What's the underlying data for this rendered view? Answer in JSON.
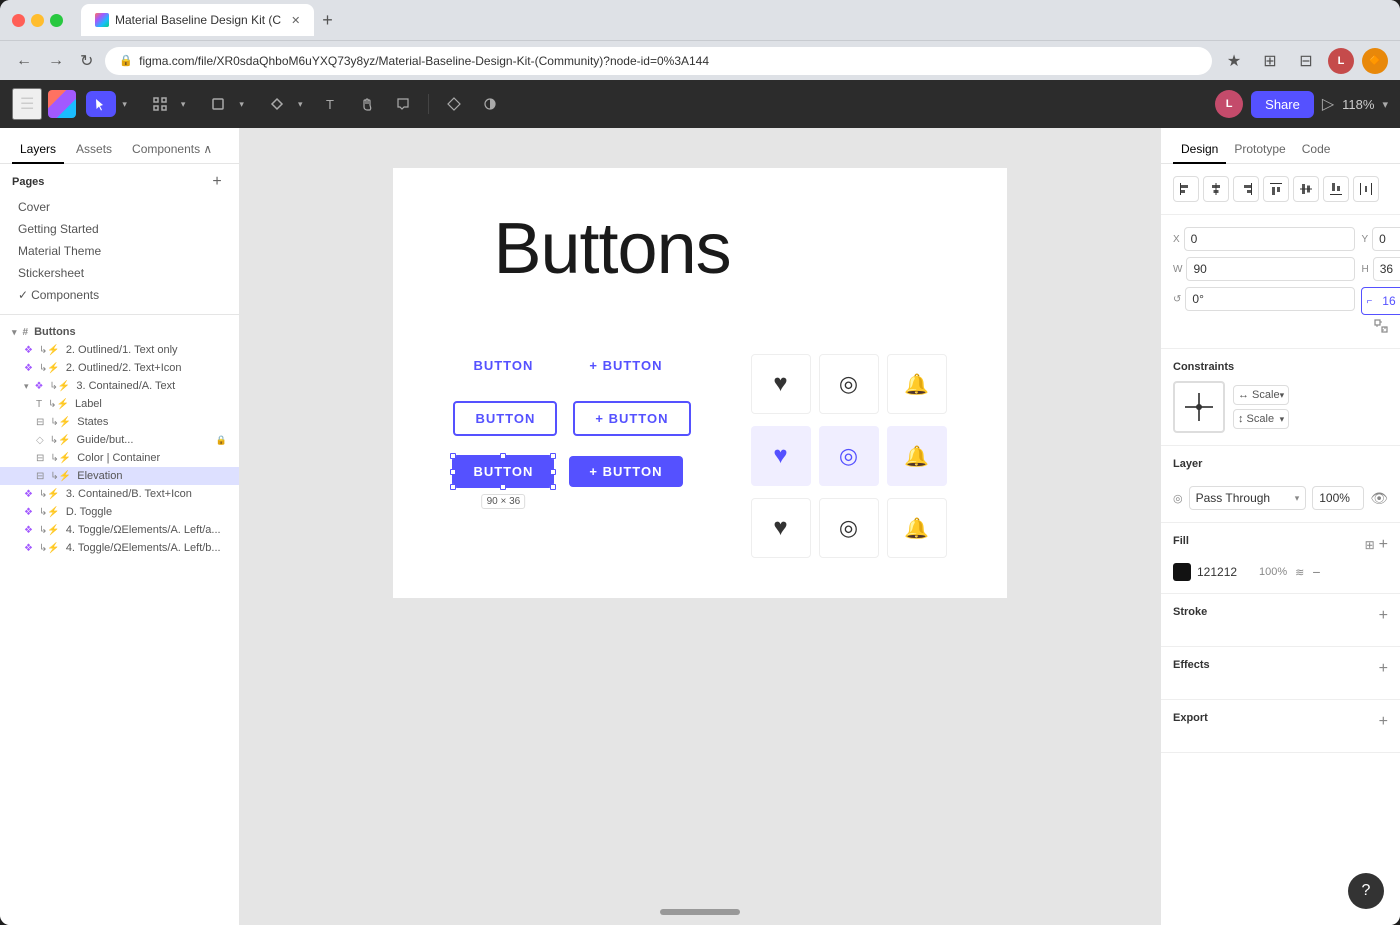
{
  "browser": {
    "url": "figma.com/file/XR0sdaQhboM6uYXQ73y8yz/Material-Baseline-Design-Kit-(Community)?node-id=0%3A144",
    "tab_title": "Material Baseline Design Kit (C",
    "new_tab_label": "+"
  },
  "figma_toolbar": {
    "zoom": "118%",
    "share_label": "Share",
    "avatar_initials": "L"
  },
  "left_panel": {
    "tabs": [
      "Layers",
      "Assets",
      "Components ^"
    ],
    "pages_title": "Pages",
    "pages": [
      {
        "label": "Cover"
      },
      {
        "label": "Getting Started"
      },
      {
        "label": "Material Theme"
      },
      {
        "label": "Stickersheet"
      },
      {
        "label": "Components"
      }
    ],
    "layers_title": "Buttons",
    "layer_items": [
      {
        "label": "2. Outlined/1. Text only",
        "indent": 1,
        "icon": "component"
      },
      {
        "label": "2. Outlined/2. Text+Icon",
        "indent": 1,
        "icon": "component"
      },
      {
        "label": "3. Contained/A. Text",
        "indent": 1,
        "icon": "component"
      },
      {
        "label": "Label",
        "indent": 2,
        "icon": "text"
      },
      {
        "label": "States",
        "indent": 2,
        "icon": "group"
      },
      {
        "label": "Guide/but...",
        "indent": 2,
        "icon": "shape",
        "locked": true
      },
      {
        "label": "Color | Container",
        "indent": 2,
        "icon": "group"
      },
      {
        "label": "Elevation",
        "indent": 2,
        "icon": "group",
        "selected": true
      },
      {
        "label": "3. Contained/B. Text+Icon",
        "indent": 1,
        "icon": "component"
      },
      {
        "label": "D. Toggle",
        "indent": 1,
        "icon": "component"
      },
      {
        "label": "4. Toggle/ΩElements/A. Left/a...",
        "indent": 1,
        "icon": "component"
      },
      {
        "label": "4. Toggle/ΩElements/A. Left/b...",
        "indent": 1,
        "icon": "component"
      }
    ]
  },
  "canvas": {
    "title": "Buttons",
    "selected_size": "90 × 36",
    "rows": [
      {
        "buttons": [
          {
            "type": "text-only",
            "label": "BUTTON"
          },
          {
            "type": "text-icon",
            "label": "+ BUTTON"
          }
        ]
      },
      {
        "buttons": [
          {
            "type": "outlined-text",
            "label": "BUTTON"
          },
          {
            "type": "outlined-icon",
            "label": "+ BUTTON"
          }
        ]
      },
      {
        "buttons": [
          {
            "type": "contained-text",
            "label": "BUTTON",
            "selected": true
          },
          {
            "type": "contained-icon",
            "label": "+ BUTTON"
          }
        ]
      }
    ],
    "icon_grid": [
      [
        {
          "icon": "♥",
          "bg": "plain"
        },
        {
          "icon": "◉",
          "bg": "plain"
        },
        {
          "icon": "🔔",
          "bg": "plain"
        }
      ],
      [
        {
          "icon": "♥",
          "bg": "purple"
        },
        {
          "icon": "◉",
          "bg": "purple"
        },
        {
          "icon": "🔔",
          "bg": "purple"
        }
      ],
      [
        {
          "icon": "♥",
          "bg": "plain"
        },
        {
          "icon": "◉",
          "bg": "plain"
        },
        {
          "icon": "🔔",
          "bg": "plain"
        }
      ]
    ]
  },
  "right_panel": {
    "tabs": [
      "Design",
      "Prototype",
      "Code"
    ],
    "active_tab": "Design",
    "alignment": {
      "buttons": [
        "⊢",
        "⊣",
        "⊤",
        "⊥",
        "⊦",
        "⊧",
        "⋯"
      ]
    },
    "x": {
      "label": "X",
      "value": "0"
    },
    "y": {
      "label": "Y",
      "value": "0"
    },
    "w": {
      "label": "W",
      "value": "90"
    },
    "h": {
      "label": "H",
      "value": "36"
    },
    "rotation": {
      "label": "°",
      "value": "0°"
    },
    "corner_radius": {
      "label": "",
      "value": "16"
    },
    "constraints": {
      "title": "Constraints",
      "h_label": "↔ Scale",
      "v_label": "↕ Scale"
    },
    "layer": {
      "title": "Layer",
      "mode": "Pass Through",
      "opacity": "100%"
    },
    "fill": {
      "title": "Fill",
      "color": "121212",
      "opacity": "100%"
    },
    "stroke": {
      "title": "Stroke"
    },
    "effects": {
      "title": "Effects"
    },
    "export": {
      "title": "Export"
    }
  },
  "icons": {
    "hamburger": "☰",
    "back": "←",
    "forward": "→",
    "refresh": "↻",
    "lock": "🔒",
    "star": "★",
    "puzzle": "⊞",
    "grid": "⊟",
    "close": "✕",
    "add": "+",
    "eye": "◎",
    "chevron_down": "▾",
    "chevron_right": "▸",
    "question": "?",
    "align_left": "⊢",
    "align_center_h": "⊣",
    "align_right": "⊤",
    "align_top": "⊥",
    "align_center_v": "⊦",
    "align_bottom": "⊧",
    "distribute": "⋯"
  }
}
